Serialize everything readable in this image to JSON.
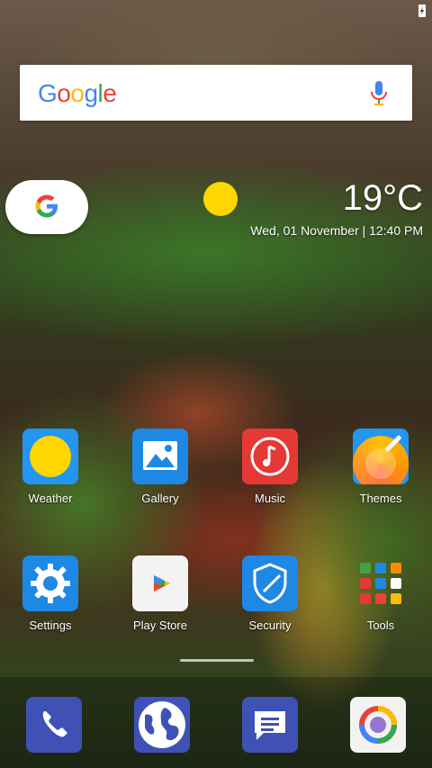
{
  "search": {
    "logo_text": "Google",
    "logo_letters": [
      "G",
      "o",
      "o",
      "g",
      "l",
      "e"
    ]
  },
  "weather": {
    "temperature": "19°C",
    "datetime": "Wed, 01 November | 12:40 PM"
  },
  "apps": [
    {
      "name": "weather",
      "label": "Weather"
    },
    {
      "name": "gallery",
      "label": "Gallery"
    },
    {
      "name": "music",
      "label": "Music"
    },
    {
      "name": "themes",
      "label": "Themes"
    },
    {
      "name": "settings",
      "label": "Settings"
    },
    {
      "name": "play-store",
      "label": "Play Store"
    },
    {
      "name": "security",
      "label": "Security"
    },
    {
      "name": "tools",
      "label": "Tools"
    }
  ],
  "dock": [
    {
      "name": "phone",
      "icon": "phone-icon"
    },
    {
      "name": "browser",
      "icon": "globe-icon"
    },
    {
      "name": "messages",
      "icon": "message-icon"
    },
    {
      "name": "camera",
      "icon": "camera-icon"
    }
  ],
  "colors": {
    "google_blue": "#4285F4",
    "google_red": "#EA4335",
    "google_yellow": "#FBBC05",
    "google_green": "#34A853",
    "sun": "#FFD600"
  }
}
